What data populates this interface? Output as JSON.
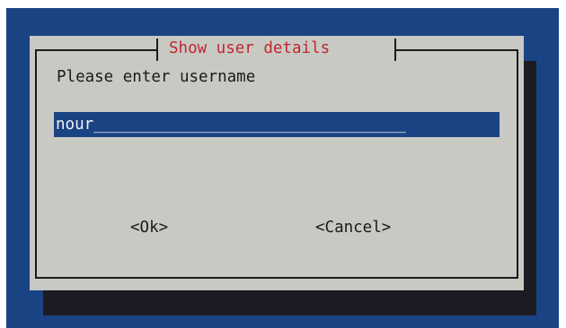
{
  "dialog": {
    "title": "Show user details",
    "prompt": "Please enter username",
    "input_value": "nour",
    "input_fill": "_________________________________",
    "ok_label": "<Ok>",
    "cancel_label": "<Cancel>"
  },
  "colors": {
    "screen_background": "#1a4383",
    "dialog_background": "#c9c9c4",
    "title_color": "#c0272d",
    "shadow": "#1b1b23"
  }
}
